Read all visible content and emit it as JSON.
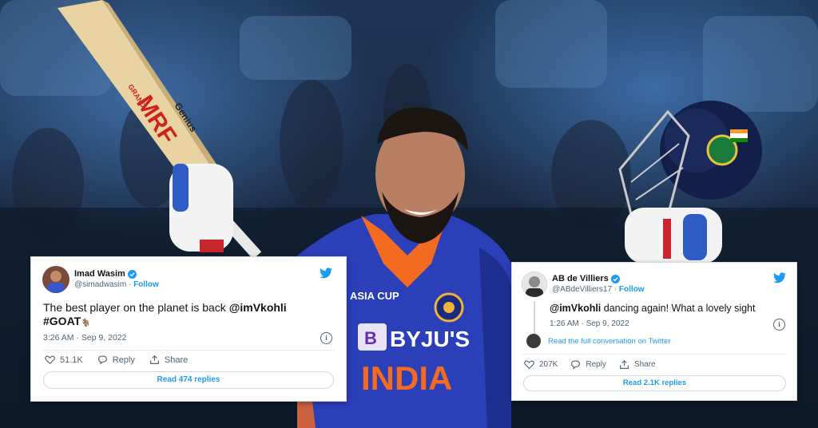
{
  "colors": {
    "twitter_blue": "#1d9bf0",
    "jersey_blue": "#2a3fb8",
    "jersey_orange": "#f36a21"
  },
  "background": {
    "bat_brand": "MRF",
    "bat_model": "Genius",
    "bat_maker": "GRAND",
    "jersey_sponsor": "BYJU'S",
    "jersey_team": "INDIA",
    "jersey_event": "ASIA CUP"
  },
  "tweets": [
    {
      "avatar": "avatar-photo",
      "name": "Imad Wasim",
      "handle": "@simadwasim",
      "separator": "·",
      "follow": "Follow",
      "text_plain": "The best player on the planet is back ",
      "mention": "@imVkohli",
      "hashtag": "#GOAT",
      "hashtag_emoji": "🐐",
      "timestamp": "3:26 AM · Sep 9, 2022",
      "info_icon": "i",
      "likes": "51.1K",
      "reply": "Reply",
      "share": "Share",
      "read_button": "Read 474 replies"
    },
    {
      "avatar": "avatar-photo",
      "name": "AB de Villiers",
      "handle": "@ABdeVilliers17",
      "separator": "·",
      "follow": "Follow",
      "mention": "@imVkohli",
      "text_plain": " dancing again! What a lovely sight",
      "timestamp": "1:26 AM · Sep 9, 2022",
      "info_icon": "i",
      "conversation_link": "Read the full conversation on Twitter",
      "likes": "207K",
      "reply": "Reply",
      "share": "Share",
      "read_button": "Read 2.1K replies"
    }
  ]
}
